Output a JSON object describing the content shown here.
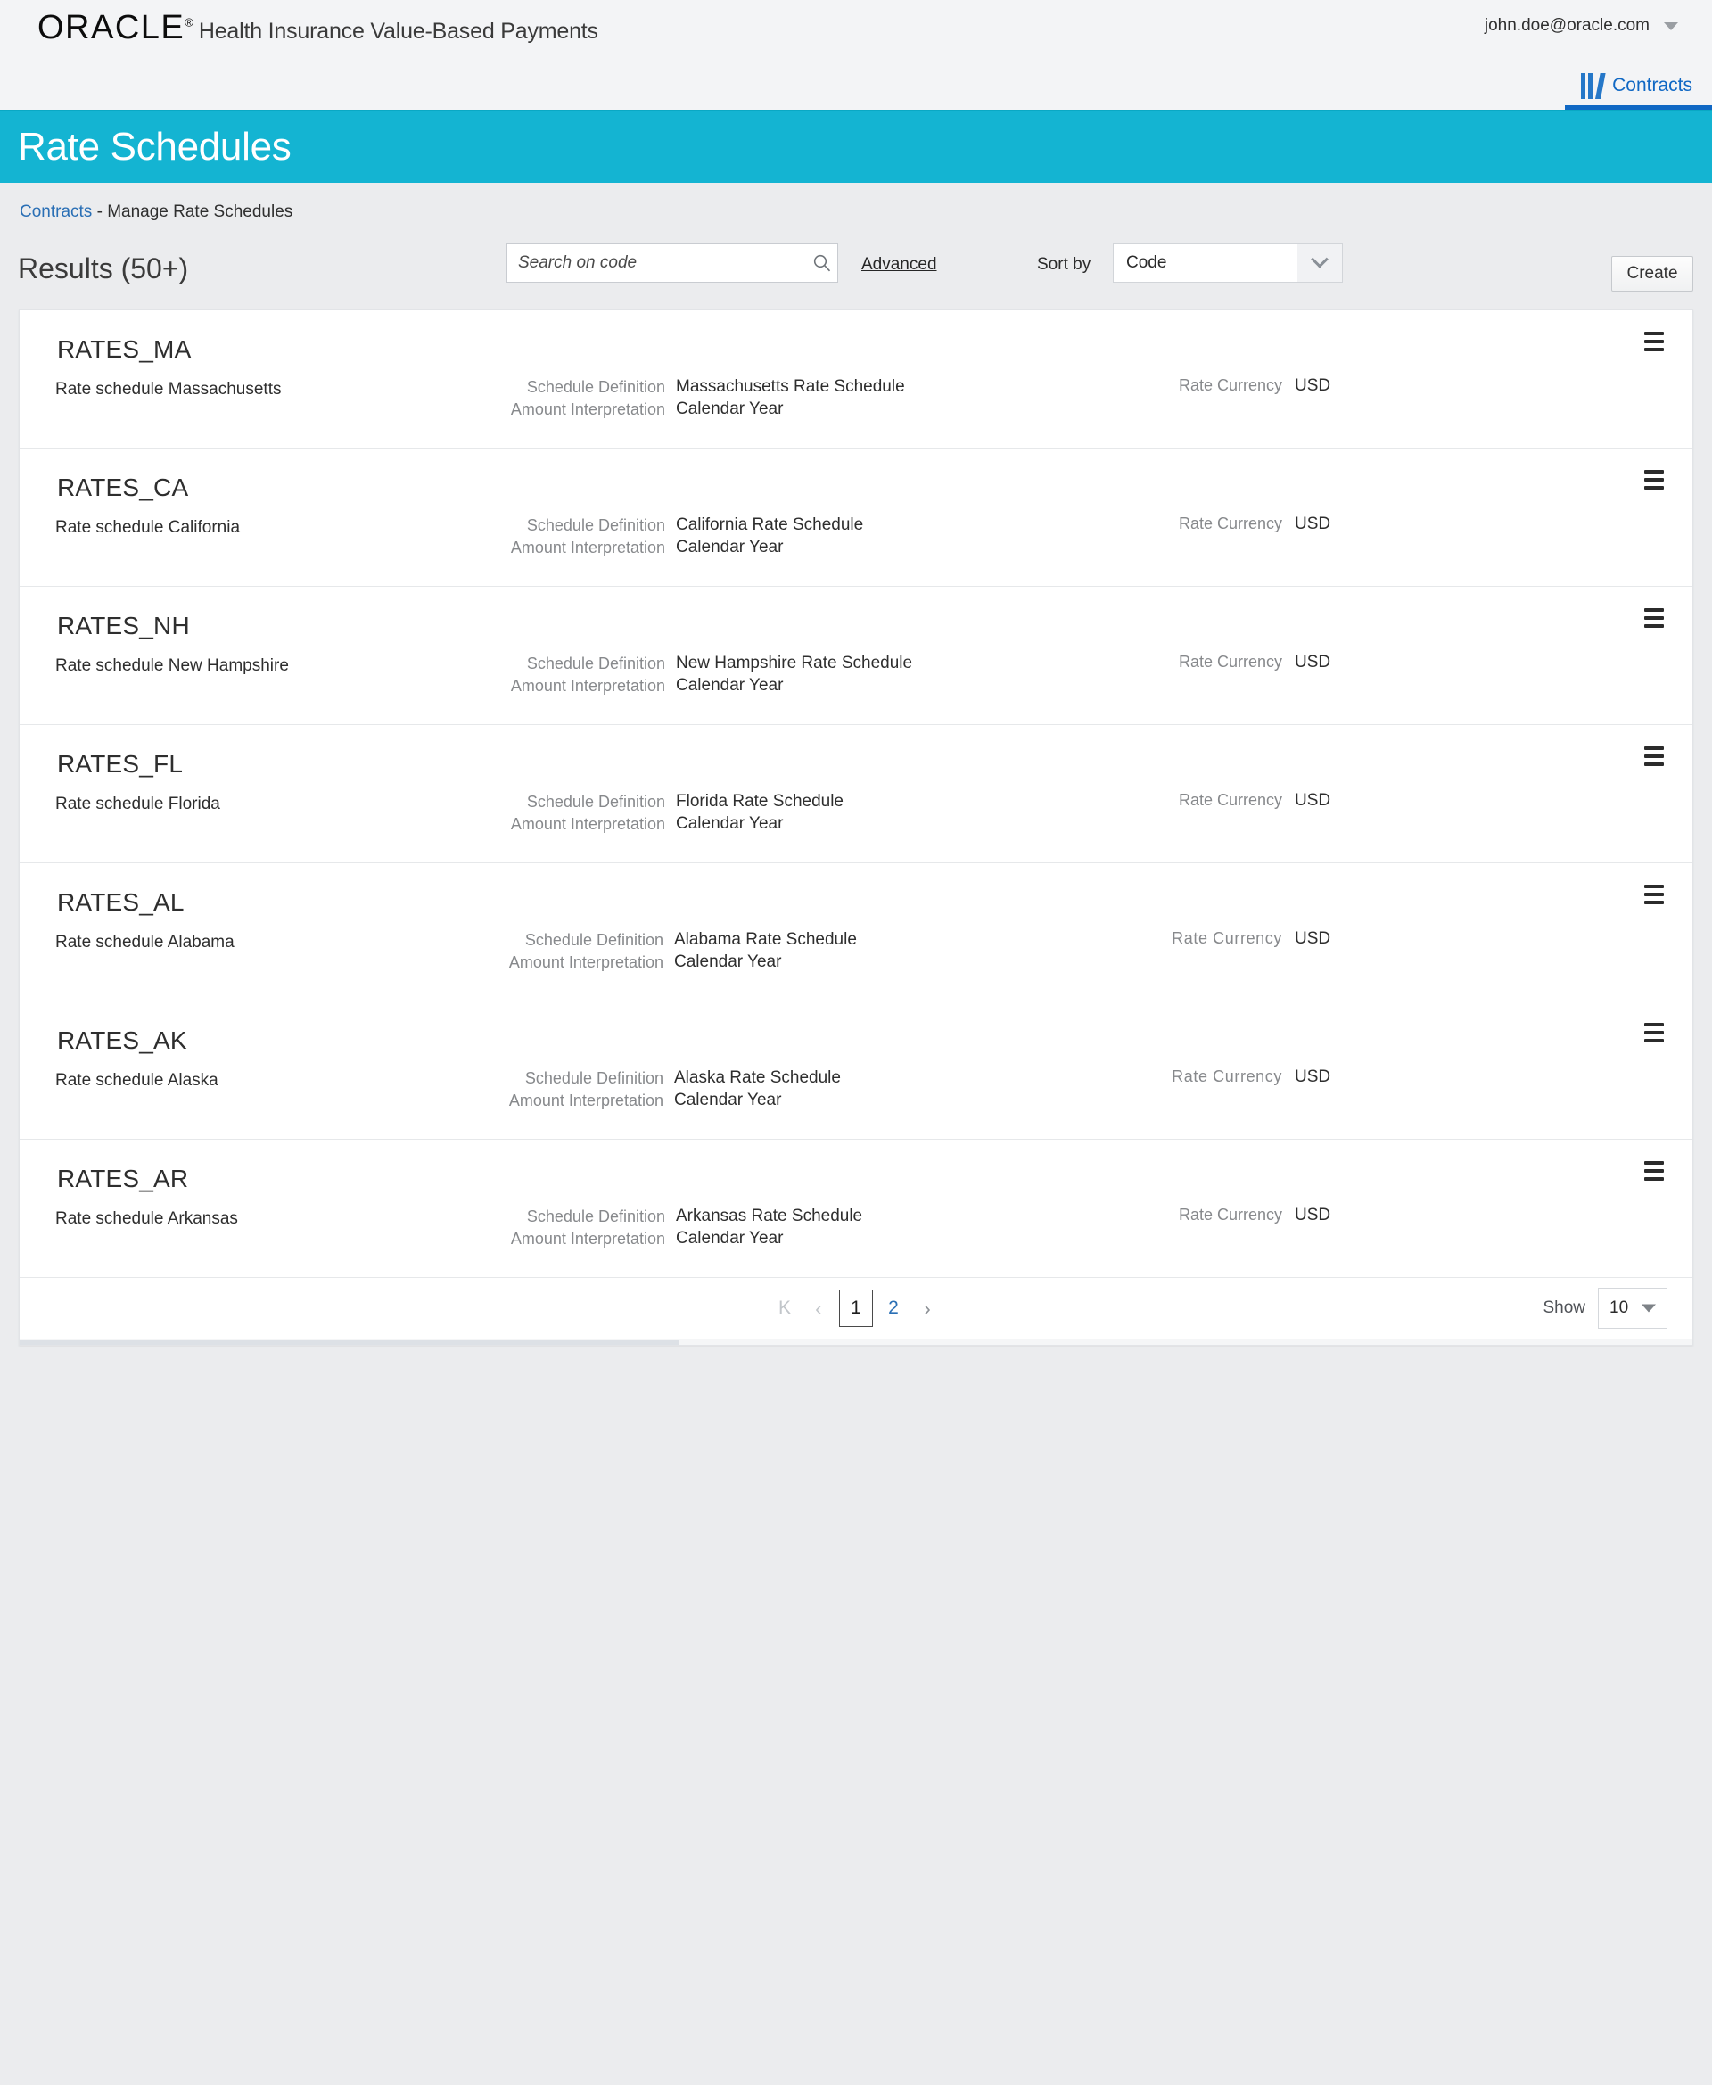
{
  "header": {
    "logo_text": "ORACLE",
    "logo_mark": "®",
    "app_name": "Health Insurance Value-Based Payments",
    "user_email": "john.doe@oracle.com",
    "user_caret_icon": "chevron-down-icon",
    "tabs": [
      {
        "label": "Contracts",
        "icon": "books-icon",
        "active": true
      }
    ]
  },
  "page": {
    "title": "Rate Schedules"
  },
  "breadcrumb": {
    "root_label": "Contracts",
    "separator": "-",
    "current_label": "Manage Rate Schedules"
  },
  "search": {
    "placeholder": "Search on code",
    "value": "",
    "icon": "search-icon",
    "advanced_label": "Advanced"
  },
  "sort": {
    "label": "Sort by",
    "value": "Code",
    "icon": "chevron-down-icon",
    "options": [
      "Code"
    ]
  },
  "results": {
    "title": "Results (50+)",
    "create_label": "Create"
  },
  "labels": {
    "schedule_definition": "Schedule Definition",
    "amount_interpretation": "Amount Interpretation",
    "rate_currency": "Rate Currency",
    "row_menu_icon": "hamburger-menu-icon"
  },
  "rows": [
    {
      "code": "RATES_MA",
      "description": "Rate schedule Massachusetts",
      "schedule_definition_label": "Schedule Definition",
      "schedule_definition": "Massachusetts Rate Schedule",
      "amount_interpretation_label": "Amount Interpretation",
      "amount_interpretation": "Calendar Year",
      "rate_currency_label": "Rate Currency",
      "rate_currency": "USD"
    },
    {
      "code": "RATES_CA",
      "description": "Rate schedule  California",
      "schedule_definition_label": "Schedule Definition",
      "schedule_definition": "California Rate Schedule",
      "amount_interpretation_label": "Amount Interpretation",
      "amount_interpretation": "Calendar Year",
      "rate_currency_label": "Rate Currency",
      "rate_currency": "USD"
    },
    {
      "code": "RATES_NH",
      "description": "Rate schedule New Hampshire",
      "schedule_definition_label": "Schedule Definition",
      "schedule_definition": "New Hampshire Rate Schedule",
      "amount_interpretation_label": "Amount Interpretation",
      "amount_interpretation": "Calendar Year",
      "rate_currency_label": "Rate Currency",
      "rate_currency": "USD"
    },
    {
      "code": "RATES_FL",
      "description": "Rate schedule Florida",
      "schedule_definition_label": "Schedule Definition",
      "schedule_definition": "Florida Rate Schedule",
      "amount_interpretation_label": "Amount Interpretation",
      "amount_interpretation": "Calendar Year",
      "rate_currency_label": "Rate Currency",
      "rate_currency": "USD"
    },
    {
      "code": "RATES_AL",
      "description": "Rate schedule Alabama",
      "schedule_definition_label": "Schedule Definition",
      "schedule_definition": "Alabama Rate Schedule",
      "amount_interpretation_label": "Amount Interpretation",
      "amount_interpretation": "Calendar Year",
      "rate_currency_label": "Rate  Currency",
      "rate_currency": "USD"
    },
    {
      "code": "RATES_AK",
      "description": "Rate schedule Alaska",
      "schedule_definition_label": "Schedule Definition",
      "schedule_definition": "Alaska Rate Schedule",
      "amount_interpretation_label": "Amount Interpretation",
      "amount_interpretation": "Calendar Year",
      "rate_currency_label": "Rate  Currency",
      "rate_currency": "USD"
    },
    {
      "code": "RATES_AR",
      "description": "Rate schedule Arkansas",
      "schedule_definition_label": "Schedule Definition",
      "schedule_definition": "Arkansas Rate Schedule",
      "amount_interpretation_label": "Amount Interpretation",
      "amount_interpretation": "Calendar Year",
      "rate_currency_label": "Rate Currency",
      "rate_currency": "USD"
    }
  ],
  "pagination": {
    "first_label": "K",
    "prev_label": "‹",
    "pages": [
      {
        "label": "1",
        "current": true
      },
      {
        "label": "2",
        "current": false
      }
    ],
    "next_label": "›",
    "show_label": "Show",
    "show_value": "10",
    "show_caret_icon": "caret-down-icon"
  },
  "colors": {
    "title_band": "#14b4d2",
    "link": "#2a6fb5",
    "tab_accent": "#1068c4",
    "page_background": "#ebecee"
  }
}
